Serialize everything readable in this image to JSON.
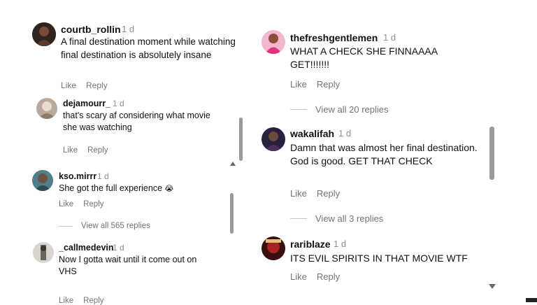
{
  "left_panel": {
    "comments": [
      {
        "username": "courtb_rollin",
        "time": "1 d",
        "text": "A final destination moment while watching final destination is absolutely insane",
        "like": "Like",
        "reply": "Reply"
      },
      {
        "username": "dejamourr_",
        "time": "1 d",
        "text": "that's scary af considering what movie she was watching",
        "like": "Like",
        "reply": "Reply"
      },
      {
        "username": "kso.mirrr",
        "time": "1 d",
        "text": "She got the full experience",
        "emoji": "😭",
        "like": "Like",
        "reply": "Reply",
        "view_replies": "View all 565 replies"
      },
      {
        "username": "_callmedevin",
        "time": "1 d",
        "text": "Now I gotta wait until it come out on VHS",
        "like": "Like",
        "reply": "Reply"
      }
    ]
  },
  "right_panel": {
    "comments": [
      {
        "username": "thefreshgentlemen",
        "time": "1 d",
        "text": "WHAT A CHECK SHE FINNAAAA GET!!!!!!!",
        "like": "Like",
        "reply": "Reply",
        "view_replies": "View all 20 replies"
      },
      {
        "username": "wakalifah",
        "time": "1 d",
        "text": "Damn that was almost her final destination. God is good. GET THAT CHECK",
        "like": "Like",
        "reply": "Reply",
        "view_replies": "View all 3 replies"
      },
      {
        "username": "rariblaze",
        "time": "1 d",
        "text": "ITS EVIL SPIRITS IN THAT MOVIE WTF",
        "like": "Like",
        "reply": "Reply"
      }
    ]
  },
  "icons": {
    "scroll_up": "chevron-up-icon",
    "scroll_down": "chevron-down-icon"
  },
  "colors": {
    "username": "#111111",
    "secondary": "#737373",
    "scrollbar": "#9a9a9a"
  }
}
